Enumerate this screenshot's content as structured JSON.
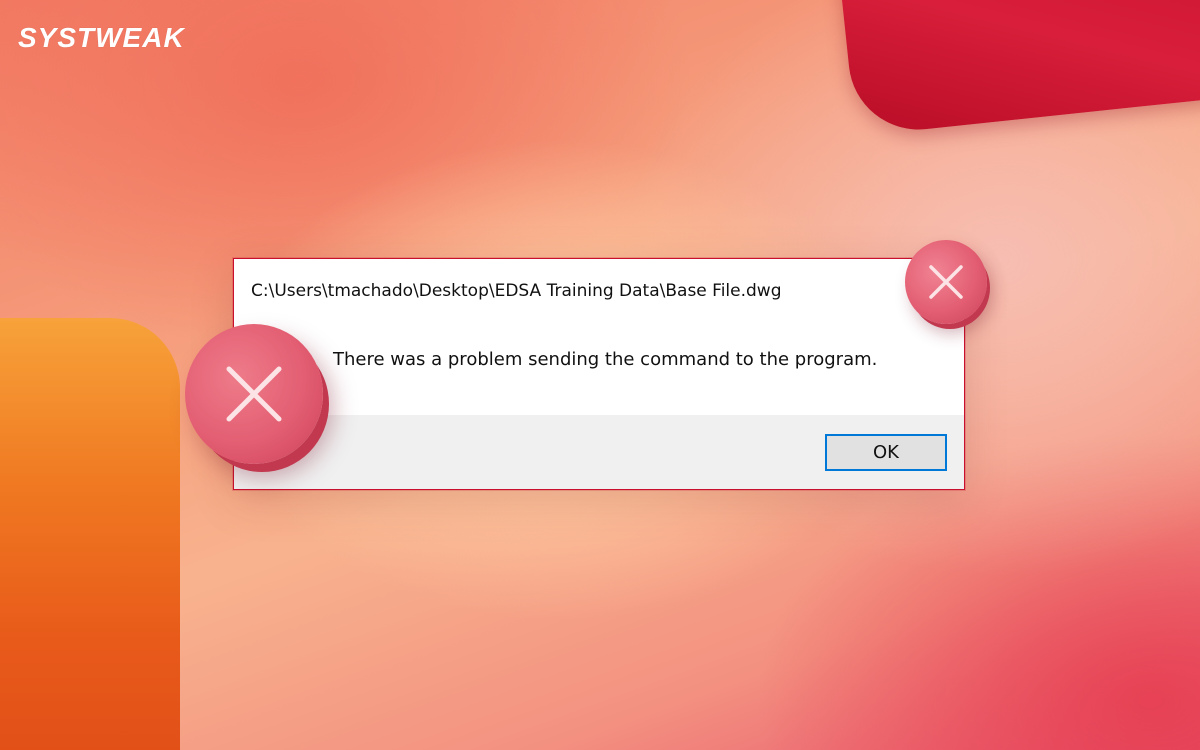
{
  "brand": {
    "logo_text": "SYSTWEAK"
  },
  "dialog": {
    "title": "C:\\Users\\tmachado\\Desktop\\EDSA Training Data\\Base File.dwg",
    "message": "There was a problem sending the command to the program.",
    "ok_label": "OK"
  },
  "decorations": {
    "large_badge_icon": "close-icon",
    "small_badge_icon": "close-icon"
  },
  "colors": {
    "accent_blue": "#0078d7",
    "badge_pink": "#e35e72",
    "dialog_border": "#c8102e"
  }
}
